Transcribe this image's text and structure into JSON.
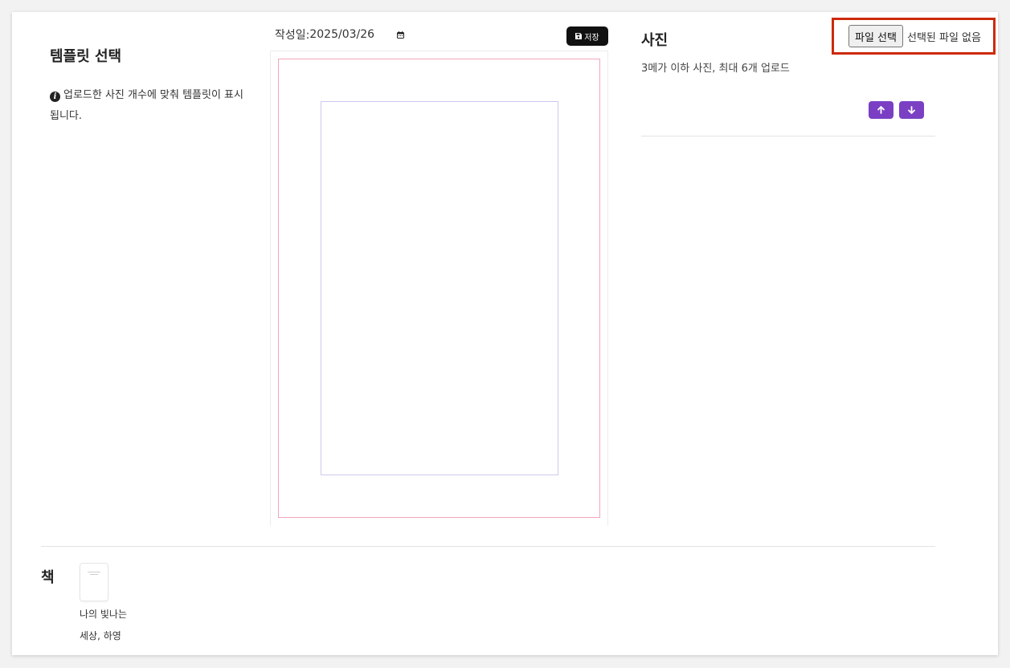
{
  "template": {
    "title": "템플릿 선택",
    "info": "업로드한 사진 개수에 맞춰 템플릿이 표시됩니다."
  },
  "editor": {
    "date_label": "작성일:",
    "date_value": "2025/03/26",
    "save_label": "저장",
    "frame_outer_color": "#f4a6b6",
    "frame_inner_color": "#cfc8ee"
  },
  "photos": {
    "title": "사진",
    "description": "3메가 이하 사진, 최대 6개 업로드",
    "file_button_label": "파일 선택",
    "file_status": "선택된 파일 없음",
    "highlight_color": "#cc2a0a",
    "accent_color": "#7b3fc4",
    "move_up_icon": "arrow-up-icon",
    "move_down_icon": "arrow-down-icon"
  },
  "book": {
    "title": "책",
    "caption": "나의 빛나는 세상, 하영"
  }
}
